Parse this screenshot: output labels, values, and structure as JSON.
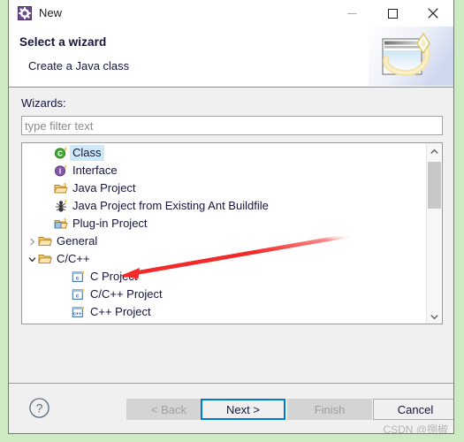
{
  "window": {
    "title": "New",
    "icon": "eclipse-wizard-icon",
    "controls": {
      "minimize": "minimize-icon",
      "maximize": "maximize-icon",
      "close": "close-icon"
    }
  },
  "header": {
    "title": "Select a wizard",
    "description": "Create a Java class",
    "banner_icon": "wizard-banner-icon"
  },
  "body": {
    "wizards_label": "Wizards:",
    "filter": {
      "value": "",
      "placeholder": "type filter text"
    }
  },
  "tree": {
    "items": [
      {
        "label": "Class",
        "icon": "java-class-icon",
        "indent": 1,
        "twisty": "",
        "selected": true
      },
      {
        "label": "Interface",
        "icon": "java-interface-icon",
        "indent": 1,
        "twisty": "",
        "selected": false
      },
      {
        "label": "Java Project",
        "icon": "java-project-icon",
        "indent": 1,
        "twisty": "",
        "selected": false
      },
      {
        "label": "Java Project from Existing Ant Buildfile",
        "icon": "ant-buildfile-icon",
        "indent": 1,
        "twisty": "",
        "selected": false
      },
      {
        "label": "Plug-in Project",
        "icon": "plugin-project-icon",
        "indent": 1,
        "twisty": "",
        "selected": false
      },
      {
        "label": "General",
        "icon": "folder-icon",
        "indent": 0,
        "twisty": "collapsed",
        "selected": false
      },
      {
        "label": "C/C++",
        "icon": "folder-icon",
        "indent": 0,
        "twisty": "expanded",
        "selected": false
      },
      {
        "label": "C Project",
        "icon": "c-project-icon",
        "indent": 2,
        "twisty": "",
        "selected": false
      },
      {
        "label": "C/C++ Project",
        "icon": "c-project-icon",
        "indent": 2,
        "twisty": "",
        "selected": false
      },
      {
        "label": "C++ Project",
        "icon": "cpp-project-icon",
        "indent": 2,
        "twisty": "",
        "selected": false
      }
    ],
    "scrollbar": {
      "up_icon": "chevron-up-icon",
      "down_icon": "chevron-down-icon"
    }
  },
  "footer": {
    "help_icon": "help-icon",
    "buttons": [
      {
        "label": "< Back",
        "state": "disabled"
      },
      {
        "label": "Next >",
        "state": "focused"
      },
      {
        "label": "Finish",
        "state": "disabled"
      },
      {
        "label": "Cancel",
        "state": "enabled"
      }
    ]
  },
  "watermark": "CSDN @捌椒",
  "annotation": {
    "type": "arrow",
    "color": "#f22a2a",
    "points_to": "C Project"
  },
  "colors": {
    "page_background": "#cdeac2",
    "dialog_background": "#f0f0f0",
    "header_background": "#ffffff",
    "selection": "#cde8f6",
    "focus_border": "#0078d7",
    "annotation": "#f22a2a"
  }
}
